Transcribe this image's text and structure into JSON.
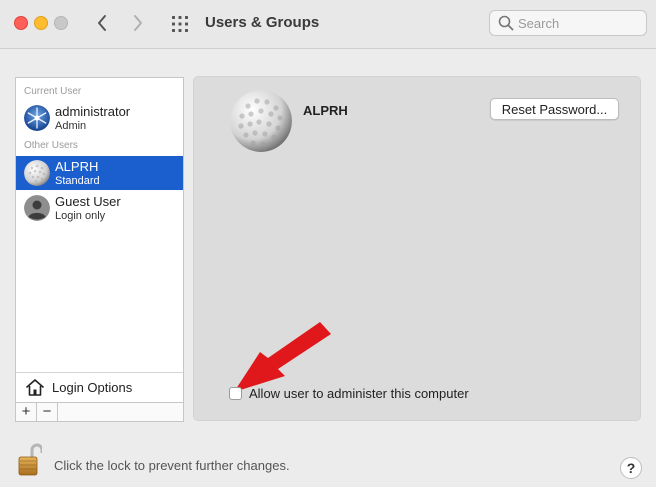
{
  "window": {
    "title": "Users & Groups"
  },
  "search": {
    "placeholder": "Search",
    "value": ""
  },
  "sidebar": {
    "current_user_label": "Current User",
    "other_users_label": "Other Users",
    "users": [
      {
        "name": "administrator",
        "role": "Admin",
        "avatar": "snowflake-avatar",
        "selected": false
      },
      {
        "name": "ALPRH",
        "role": "Standard",
        "avatar": "golf-ball-avatar",
        "selected": true
      },
      {
        "name": "Guest User",
        "role": "Login only",
        "avatar": "guest-silhouette-avatar",
        "selected": false
      }
    ],
    "login_options_label": "Login Options",
    "add_label": "+",
    "remove_label": "−"
  },
  "main": {
    "user_name": "ALPRH",
    "reset_password_label": "Reset Password...",
    "admin_checkbox_label": "Allow user to administer this computer",
    "admin_checked": false
  },
  "footer": {
    "lock_text": "Click the lock to prevent further changes.",
    "help_label": "?"
  },
  "colors": {
    "selection": "#1b5fcf",
    "annotation_arrow": "#e0181b"
  }
}
